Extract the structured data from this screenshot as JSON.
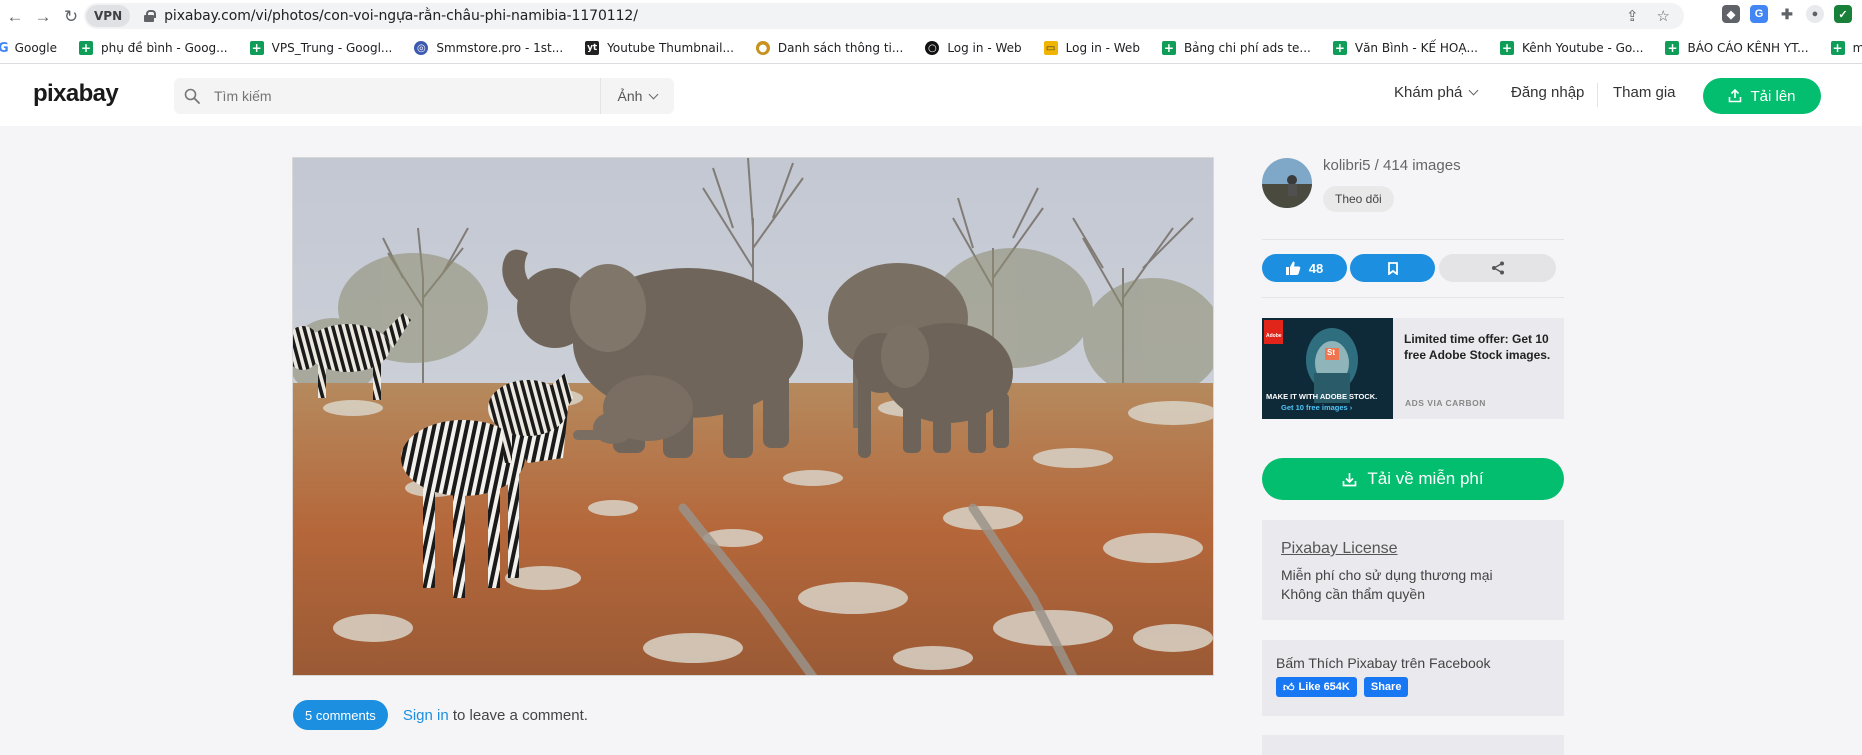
{
  "browser": {
    "vpn_label": "VPN",
    "url": "pixabay.com/vi/photos/con-voi-ngựa-rằn-châu-phi-namibia-1170112/",
    "bookmarks": [
      {
        "label": "Google",
        "icon": "google-icon"
      },
      {
        "label": "phụ đề bình - Goog...",
        "icon": "sheets-icon"
      },
      {
        "label": "VPS_Trung - Googl...",
        "icon": "sheets-icon"
      },
      {
        "label": "Smmstore.pro - 1st...",
        "icon": "globe-icon"
      },
      {
        "label": "Youtube Thumbnail...",
        "icon": "yt-logo-icon"
      },
      {
        "label": "Danh sách thông ti...",
        "icon": "site-icon"
      },
      {
        "label": "Log in - Web",
        "icon": "record-icon"
      },
      {
        "label": "Log in - Web",
        "icon": "card-icon"
      },
      {
        "label": "Bảng chi phí ads te...",
        "icon": "sheets-icon"
      },
      {
        "label": "Văn Bình - KẾ HOẠ...",
        "icon": "sheets-icon"
      },
      {
        "label": "Kênh Youtube - Go...",
        "icon": "sheets-icon"
      },
      {
        "label": "BÁO CÁO KÊNH YT...",
        "icon": "sheets-icon"
      },
      {
        "label": "mở Remote - Goog...",
        "icon": "sheets-icon"
      }
    ]
  },
  "header": {
    "logo": "pixabay",
    "search_placeholder": "Tìm kiếm",
    "search_type": "Ảnh",
    "explore": "Khám phá",
    "login": "Đăng nhập",
    "join": "Tham gia",
    "upload": "Tải lên"
  },
  "main": {
    "comments_count": "5 comments",
    "sign_in": "Sign in",
    "leave_comment": " to leave a comment."
  },
  "sidebar": {
    "author": "kolibri5 / 414 images",
    "follow": "Theo dõi",
    "likes": "48",
    "ad": {
      "image_caption": "MAKE IT WITH ADOBE STOCK.",
      "image_link": "Get 10 free images ›",
      "adobe": "Adobe",
      "st": "St",
      "text": "Limited time offer: Get 10 free Adobe Stock images.",
      "via": "ADS VIA CARBON"
    },
    "download": "Tải về miễn phí",
    "license": {
      "title": "Pixabay License",
      "line1": "Miễn phí cho sử dụng thương mại",
      "line2": "Không cần thẩm quyền"
    },
    "facebook": {
      "text": "Bấm Thích Pixabay trên Facebook",
      "like": "Like 654K",
      "share": "Share"
    }
  },
  "colors": {
    "green": "#02be6e",
    "blue": "#1c8fe0",
    "fb_blue": "#1877f2"
  }
}
